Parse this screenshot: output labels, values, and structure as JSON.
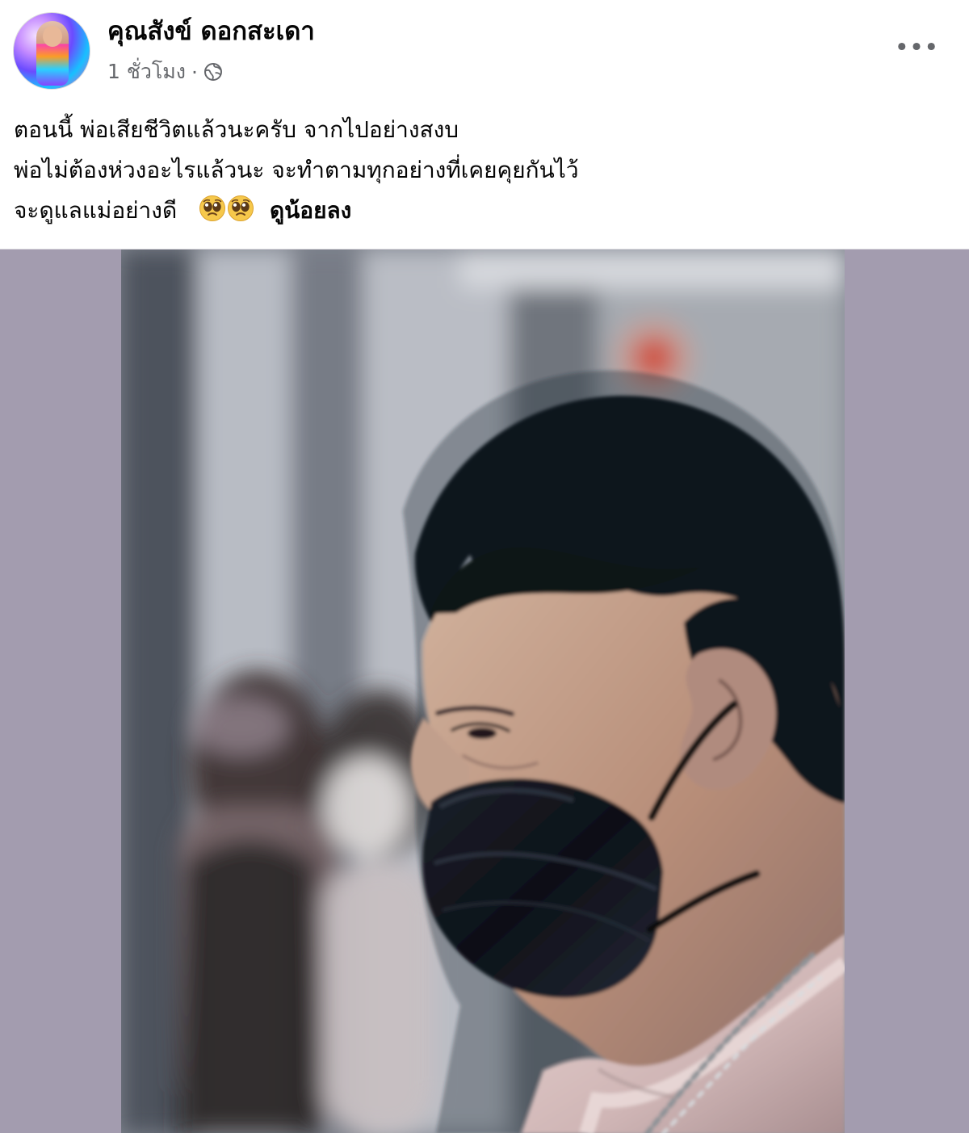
{
  "post": {
    "author_name": "คุณสังข์ ดอกสะเดา",
    "timestamp": "1 ชั่วโมง",
    "separator": "·",
    "audience_icon": "globe-icon",
    "more_icon": "more-options-icon",
    "more_label": "•••",
    "text_lines": [
      "ตอนนี้ พ่อเสียชีวิตแล้วนะครับ จากไปอย่างสงบ",
      "พ่อไม่ต้องห่วงอะไรแล้วนะ จะทำตามทุกอย่างที่เคยคุยกันไว้",
      "จะดูแลแม่อย่างดี"
    ],
    "emojis": [
      "pleading-face-emoji",
      "pleading-face-emoji"
    ],
    "see_less_label": "ดูน้อยลง",
    "photo_alt": "Man wearing a black face mask with a blurred person in the background"
  }
}
